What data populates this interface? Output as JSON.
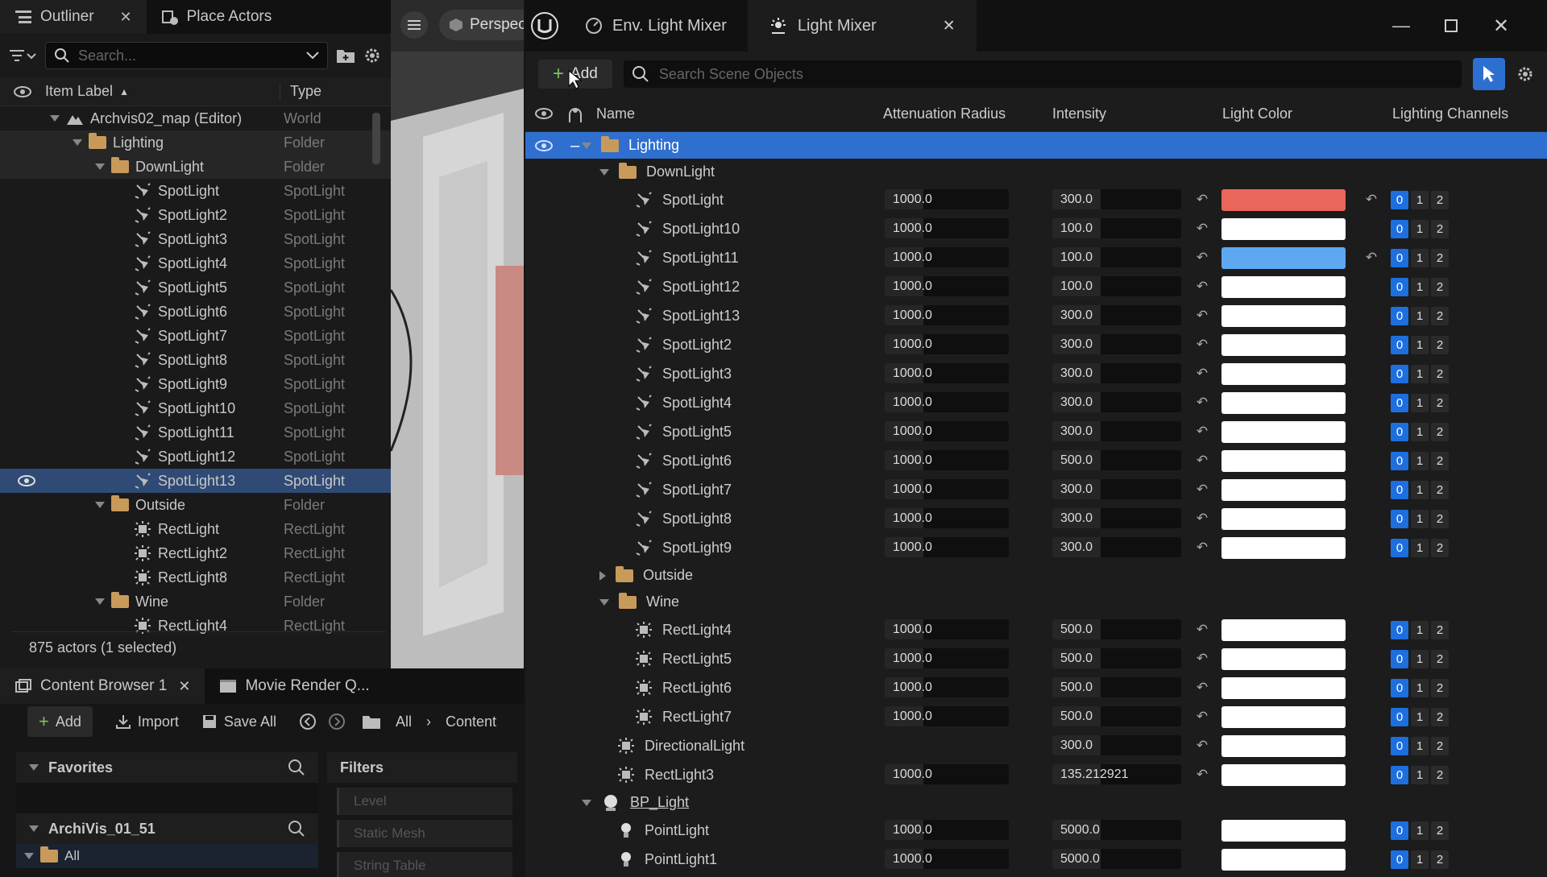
{
  "outliner": {
    "tab_outliner": "Outliner",
    "tab_place_actors": "Place Actors",
    "search_placeholder": "Search...",
    "col_label": "Item Label",
    "col_type": "Type",
    "rows": [
      {
        "label": "Archvis02_map (Editor)",
        "type": "World",
        "indent": 0,
        "kind": "world",
        "arrow": "down"
      },
      {
        "label": "Lighting",
        "type": "Folder",
        "indent": 1,
        "kind": "folder",
        "arrow": "down",
        "hl": true
      },
      {
        "label": "DownLight",
        "type": "Folder",
        "indent": 2,
        "kind": "folder",
        "arrow": "down",
        "hl": true
      },
      {
        "label": "SpotLight",
        "type": "SpotLight",
        "indent": 3,
        "kind": "spot"
      },
      {
        "label": "SpotLight2",
        "type": "SpotLight",
        "indent": 3,
        "kind": "spot"
      },
      {
        "label": "SpotLight3",
        "type": "SpotLight",
        "indent": 3,
        "kind": "spot"
      },
      {
        "label": "SpotLight4",
        "type": "SpotLight",
        "indent": 3,
        "kind": "spot"
      },
      {
        "label": "SpotLight5",
        "type": "SpotLight",
        "indent": 3,
        "kind": "spot"
      },
      {
        "label": "SpotLight6",
        "type": "SpotLight",
        "indent": 3,
        "kind": "spot"
      },
      {
        "label": "SpotLight7",
        "type": "SpotLight",
        "indent": 3,
        "kind": "spot"
      },
      {
        "label": "SpotLight8",
        "type": "SpotLight",
        "indent": 3,
        "kind": "spot"
      },
      {
        "label": "SpotLight9",
        "type": "SpotLight",
        "indent": 3,
        "kind": "spot"
      },
      {
        "label": "SpotLight10",
        "type": "SpotLight",
        "indent": 3,
        "kind": "spot"
      },
      {
        "label": "SpotLight11",
        "type": "SpotLight",
        "indent": 3,
        "kind": "spot"
      },
      {
        "label": "SpotLight12",
        "type": "SpotLight",
        "indent": 3,
        "kind": "spot"
      },
      {
        "label": "SpotLight13",
        "type": "SpotLight",
        "indent": 3,
        "kind": "spot",
        "selected": true
      },
      {
        "label": "Outside",
        "type": "Folder",
        "indent": 2,
        "kind": "folder",
        "arrow": "down"
      },
      {
        "label": "RectLight",
        "type": "RectLight",
        "indent": 3,
        "kind": "rect"
      },
      {
        "label": "RectLight2",
        "type": "RectLight",
        "indent": 3,
        "kind": "rect"
      },
      {
        "label": "RectLight8",
        "type": "RectLight",
        "indent": 3,
        "kind": "rect"
      },
      {
        "label": "Wine",
        "type": "Folder",
        "indent": 2,
        "kind": "folder",
        "arrow": "down"
      },
      {
        "label": "RectLight4",
        "type": "RectLight",
        "indent": 3,
        "kind": "rect"
      }
    ],
    "status": "875 actors (1 selected)"
  },
  "viewport": {
    "label": "Perspec"
  },
  "content_browser": {
    "tab_content": "Content Browser 1",
    "tab_movie": "Movie Render Q...",
    "add": "Add",
    "import": "Import",
    "save_all": "Save All",
    "crumb_all": "All",
    "crumb_content": "Content",
    "favorites": "Favorites",
    "filters": "Filters",
    "project": "ArchiVis_01_51",
    "tree_all": "All",
    "filter_items": [
      "Level",
      "Static Mesh",
      "String Table"
    ]
  },
  "mixer": {
    "tab_env": "Env. Light Mixer",
    "tab_light": "Light Mixer",
    "add": "Add",
    "search_placeholder": "Search Scene Objects",
    "headers": {
      "name": "Name",
      "atten": "Attenuation Radius",
      "intensity": "Intensity",
      "color": "Light Color",
      "channels": "Lighting Channels"
    },
    "rows": [
      {
        "name": "Lighting",
        "kind": "folder",
        "indent": 0,
        "arrow": "down",
        "selected": true
      },
      {
        "name": "DownLight",
        "kind": "folder",
        "indent": 1,
        "arrow": "down"
      },
      {
        "name": "SpotLight",
        "kind": "spot",
        "indent": 2,
        "atten": "1000.0",
        "intensity": "300.0",
        "color": "#e8665a",
        "colorReset": true,
        "ch": [
          true,
          false,
          false
        ]
      },
      {
        "name": "SpotLight10",
        "kind": "spot",
        "indent": 2,
        "atten": "1000.0",
        "intensity": "100.0",
        "color": "#ffffff",
        "ch": [
          true,
          false,
          false
        ]
      },
      {
        "name": "SpotLight11",
        "kind": "spot",
        "indent": 2,
        "atten": "1000.0",
        "intensity": "100.0",
        "color": "#5ea8f2",
        "colorReset": true,
        "ch": [
          true,
          false,
          false
        ]
      },
      {
        "name": "SpotLight12",
        "kind": "spot",
        "indent": 2,
        "atten": "1000.0",
        "intensity": "100.0",
        "color": "#ffffff",
        "ch": [
          true,
          false,
          false
        ]
      },
      {
        "name": "SpotLight13",
        "kind": "spot",
        "indent": 2,
        "atten": "1000.0",
        "intensity": "300.0",
        "color": "#ffffff",
        "ch": [
          true,
          false,
          false
        ]
      },
      {
        "name": "SpotLight2",
        "kind": "spot",
        "indent": 2,
        "atten": "1000.0",
        "intensity": "300.0",
        "color": "#ffffff",
        "ch": [
          true,
          false,
          false
        ]
      },
      {
        "name": "SpotLight3",
        "kind": "spot",
        "indent": 2,
        "atten": "1000.0",
        "intensity": "300.0",
        "color": "#ffffff",
        "ch": [
          true,
          false,
          false
        ]
      },
      {
        "name": "SpotLight4",
        "kind": "spot",
        "indent": 2,
        "atten": "1000.0",
        "intensity": "300.0",
        "color": "#ffffff",
        "ch": [
          true,
          false,
          false
        ]
      },
      {
        "name": "SpotLight5",
        "kind": "spot",
        "indent": 2,
        "atten": "1000.0",
        "intensity": "300.0",
        "color": "#ffffff",
        "ch": [
          true,
          false,
          false
        ]
      },
      {
        "name": "SpotLight6",
        "kind": "spot",
        "indent": 2,
        "atten": "1000.0",
        "intensity": "500.0",
        "color": "#ffffff",
        "ch": [
          true,
          false,
          false
        ]
      },
      {
        "name": "SpotLight7",
        "kind": "spot",
        "indent": 2,
        "atten": "1000.0",
        "intensity": "300.0",
        "color": "#ffffff",
        "ch": [
          true,
          false,
          false
        ]
      },
      {
        "name": "SpotLight8",
        "kind": "spot",
        "indent": 2,
        "atten": "1000.0",
        "intensity": "300.0",
        "color": "#ffffff",
        "ch": [
          true,
          false,
          false
        ]
      },
      {
        "name": "SpotLight9",
        "kind": "spot",
        "indent": 2,
        "atten": "1000.0",
        "intensity": "300.0",
        "color": "#ffffff",
        "ch": [
          true,
          false,
          false
        ]
      },
      {
        "name": "Outside",
        "kind": "folder",
        "indent": 1,
        "arrow": "right"
      },
      {
        "name": "Wine",
        "kind": "folder",
        "indent": 1,
        "arrow": "down"
      },
      {
        "name": "RectLight4",
        "kind": "rect",
        "indent": 2,
        "atten": "1000.0",
        "intensity": "500.0",
        "color": "#ffffff",
        "ch": [
          true,
          false,
          false
        ]
      },
      {
        "name": "RectLight5",
        "kind": "rect",
        "indent": 2,
        "atten": "1000.0",
        "intensity": "500.0",
        "color": "#ffffff",
        "ch": [
          true,
          false,
          false
        ]
      },
      {
        "name": "RectLight6",
        "kind": "rect",
        "indent": 2,
        "atten": "1000.0",
        "intensity": "500.0",
        "color": "#ffffff",
        "ch": [
          true,
          false,
          false
        ]
      },
      {
        "name": "RectLight7",
        "kind": "rect",
        "indent": 2,
        "atten": "1000.0",
        "intensity": "500.0",
        "color": "#ffffff",
        "ch": [
          true,
          false,
          false
        ]
      },
      {
        "name": "DirectionalLight",
        "kind": "dir",
        "indent": 1,
        "intensity": "300.0",
        "color": "#ffffff",
        "ch": [
          true,
          false,
          false
        ]
      },
      {
        "name": "RectLight3",
        "kind": "rect",
        "indent": 1,
        "atten": "1000.0",
        "intensity": "135.212921",
        "color": "#ffffff",
        "ch": [
          true,
          false,
          false
        ]
      },
      {
        "name": "BP_Light",
        "kind": "bp",
        "indent": 0,
        "arrow": "down",
        "link": true
      },
      {
        "name": "PointLight",
        "kind": "point",
        "indent": 1,
        "atten": "1000.0",
        "intensity": "5000.0",
        "color": "#ffffff",
        "noReset": true,
        "ch": [
          true,
          false,
          false
        ]
      },
      {
        "name": "PointLight1",
        "kind": "point",
        "indent": 1,
        "atten": "1000.0",
        "intensity": "5000.0",
        "color": "#ffffff",
        "noReset": true,
        "ch": [
          true,
          false,
          false
        ]
      }
    ]
  }
}
